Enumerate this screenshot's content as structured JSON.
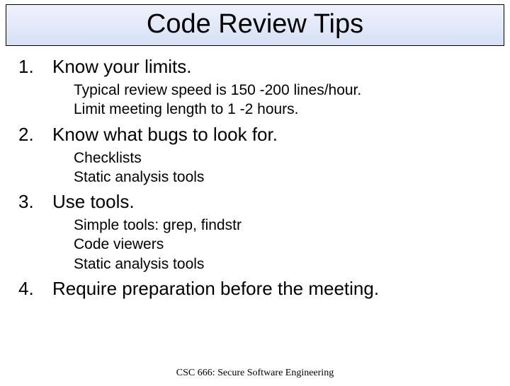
{
  "title": "Code Review Tips",
  "items": [
    {
      "num": "1.",
      "heading": "Know your limits.",
      "subs": [
        "Typical review speed is 150 -200 lines/hour.",
        "Limit meeting length to 1 -2 hours."
      ]
    },
    {
      "num": "2.",
      "heading": "Know what bugs to look for.",
      "subs": [
        "Checklists",
        "Static analysis tools"
      ]
    },
    {
      "num": "3.",
      "heading": "Use tools.",
      "subs": [
        "Simple tools: grep, findstr",
        "Code viewers",
        "Static analysis tools"
      ]
    },
    {
      "num": "4.",
      "heading": "Require preparation before the meeting.",
      "subs": []
    }
  ],
  "footer": "CSC 666: Secure Software Engineering"
}
